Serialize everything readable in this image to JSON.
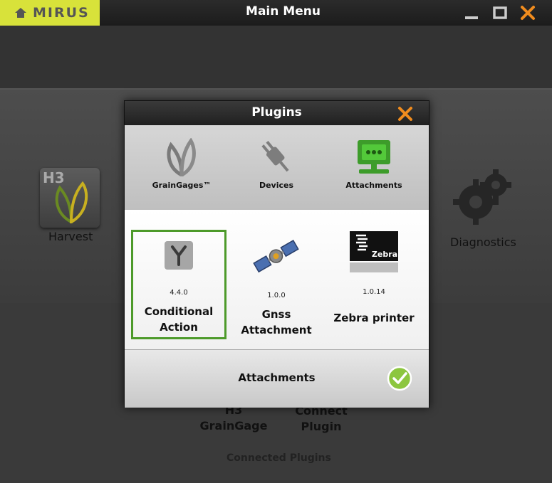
{
  "window": {
    "logo_text": "MIRUS",
    "title": "Main Menu"
  },
  "background": {
    "harvest_label": "Harvest",
    "tile_text": "H3",
    "diagnostics_label": "Diagnostics",
    "graingage_line1": "H3",
    "graingage_line2": "GrainGage",
    "connect_line1": "Connect",
    "connect_line2": "Plugin",
    "connected_plugins": "Connected Plugins"
  },
  "modal": {
    "title": "Plugins",
    "categories": [
      {
        "label": "GrainGages™",
        "icon": "leaf-icon"
      },
      {
        "label": "Devices",
        "icon": "plug-icon"
      },
      {
        "label": "Attachments",
        "icon": "attachment-icon"
      }
    ],
    "plugins": [
      {
        "version": "4.4.0",
        "name_line1": "Conditional",
        "name_line2": "Action",
        "selected": true
      },
      {
        "version": "1.0.0",
        "name_line1": "Gnss",
        "name_line2": "Attachment",
        "selected": false
      },
      {
        "version": "1.0.14",
        "name_line1": "Zebra printer",
        "name_line2": "",
        "selected": false,
        "logo_text": "Zebra"
      }
    ],
    "footer_label": "Attachments"
  },
  "colors": {
    "accent_orange": "#f08c1e",
    "logo_yellow": "#d8e23a",
    "selection_green": "#4d9a2a",
    "check_green": "#8cc63f"
  }
}
